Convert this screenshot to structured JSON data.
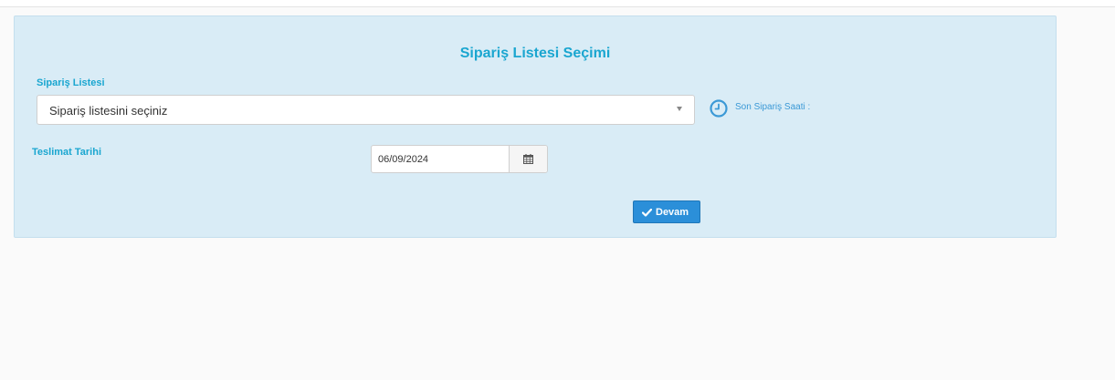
{
  "form": {
    "title": "Sipariş Listesi Seçimi",
    "list_label": "Sipariş Listesi",
    "list_placeholder": "Sipariş listesini seçiniz",
    "last_order_label": "Son Sipariş Saati :",
    "date_label": "Teslimat Tarihi",
    "date_value": "06/09/2024",
    "continue_label": "Devam"
  },
  "icons": {
    "select_arrow": "caret-down-icon",
    "clock": "clock-icon",
    "calendar": "calendar-icon",
    "check": "check-icon"
  },
  "colors": {
    "panel_bg": "#d9ecf6",
    "accent_text": "#1aa6d0",
    "button": "#2b8fd9"
  }
}
